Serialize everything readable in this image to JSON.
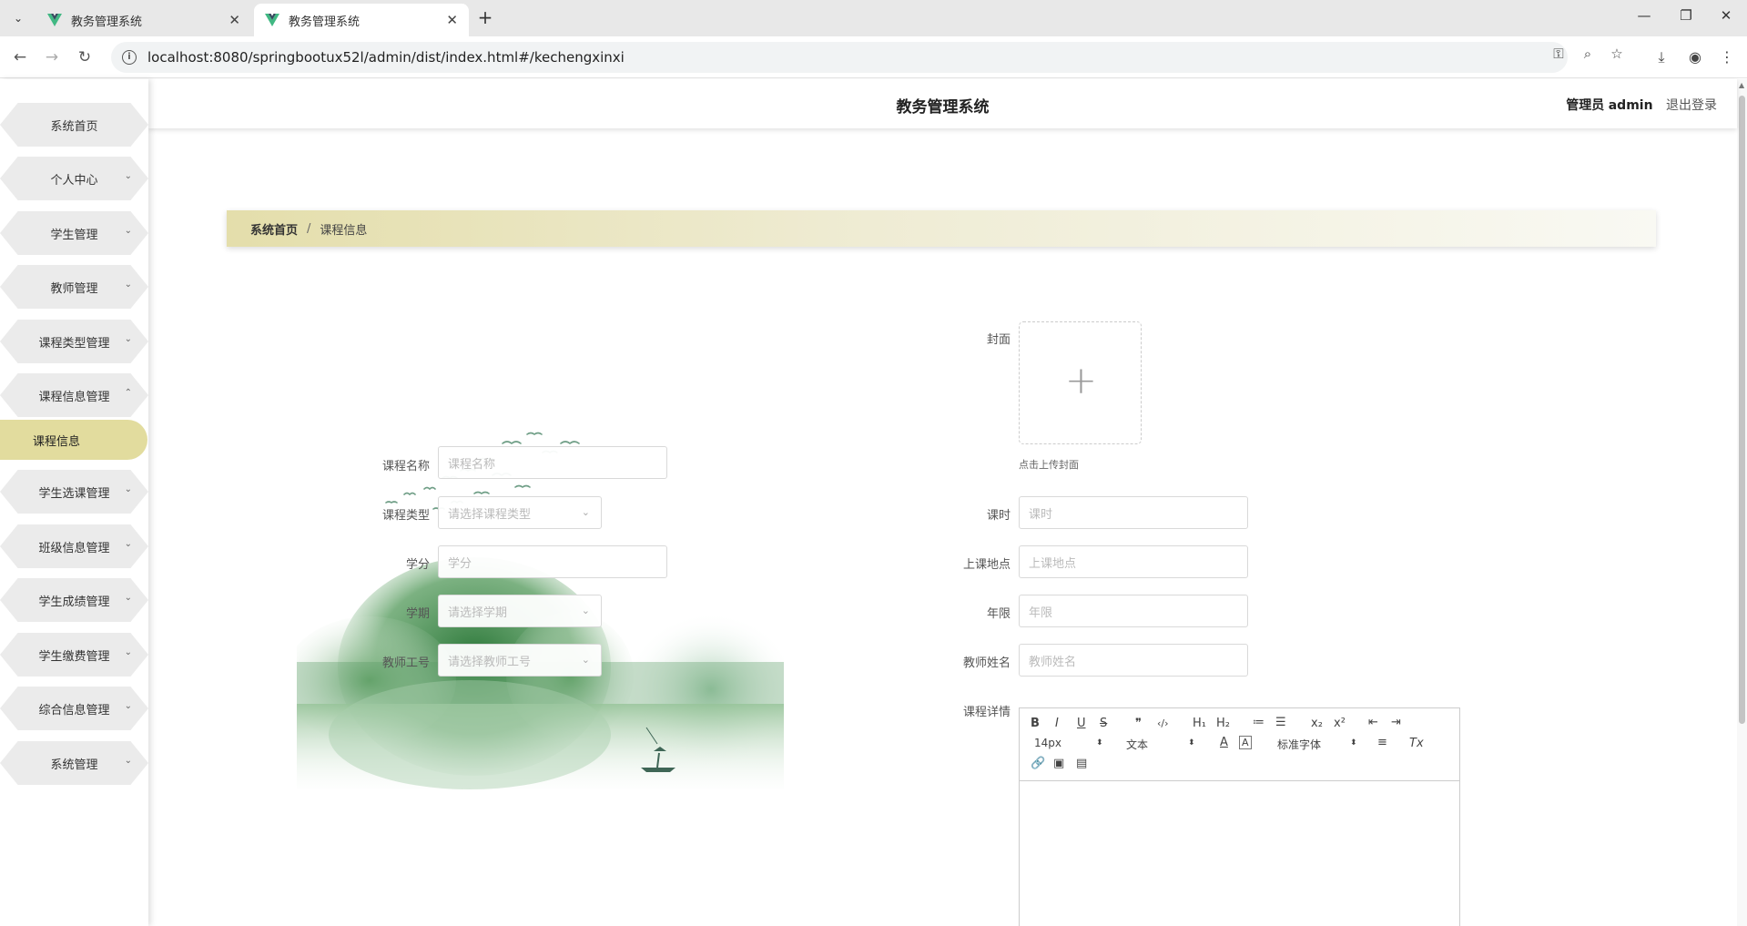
{
  "browser": {
    "tabs": [
      {
        "title": "教务管理系统",
        "active": false
      },
      {
        "title": "教务管理系统",
        "active": true
      }
    ],
    "url": "localhost:8080/springbootux52l/admin/dist/index.html#/kechengxinxi",
    "icons": [
      "tab-search-icon",
      "back-icon",
      "forward-icon",
      "reload-icon",
      "password-key-icon",
      "zoom-icon",
      "bookmark-star-icon",
      "download-icon",
      "profile-icon",
      "more-icon"
    ]
  },
  "header": {
    "title": "教务管理系统",
    "role": "管理员",
    "username": "admin",
    "logout": "退出登录"
  },
  "sidebar": {
    "items": [
      {
        "label": "系统首页",
        "arrow": ""
      },
      {
        "label": "个人中心",
        "arrow": "⌄"
      },
      {
        "label": "学生管理",
        "arrow": "⌄"
      },
      {
        "label": "教师管理",
        "arrow": "⌄"
      },
      {
        "label": "课程类型管理",
        "arrow": "⌄"
      },
      {
        "label": "课程信息管理",
        "arrow": "⌃"
      },
      {
        "label": "课程信息",
        "arrow": ""
      },
      {
        "label": "学生选课管理",
        "arrow": "⌄"
      },
      {
        "label": "班级信息管理",
        "arrow": "⌄"
      },
      {
        "label": "学生成绩管理",
        "arrow": "⌄"
      },
      {
        "label": "学生缴费管理",
        "arrow": "⌄"
      },
      {
        "label": "综合信息管理",
        "arrow": "⌄"
      },
      {
        "label": "系统管理",
        "arrow": "⌄"
      }
    ],
    "active_color": "#e2dc9e"
  },
  "breadcrumb": {
    "home": "系统首页",
    "separator": "/",
    "current": "课程信息"
  },
  "form": {
    "left": [
      {
        "label": "课程名称",
        "placeholder": "课程名称",
        "type": "input"
      },
      {
        "label": "课程类型",
        "placeholder": "请选择课程类型",
        "type": "select"
      },
      {
        "label": "学分",
        "placeholder": "学分",
        "type": "input"
      },
      {
        "label": "学期",
        "placeholder": "请选择学期",
        "type": "select"
      },
      {
        "label": "教师工号",
        "placeholder": "请选择教师工号",
        "type": "select"
      }
    ],
    "cover": {
      "label": "封面",
      "tip": "点击上传封面"
    },
    "right": [
      {
        "label": "课时",
        "placeholder": "课时"
      },
      {
        "label": "上课地点",
        "placeholder": "上课地点"
      },
      {
        "label": "年限",
        "placeholder": "年限"
      },
      {
        "label": "教师姓名",
        "placeholder": "教师姓名"
      }
    ],
    "detail": {
      "label": "课程详情",
      "toolbar": {
        "buttons_row1": [
          "B",
          "I",
          "U",
          "S",
          "❞",
          "‹/›",
          "H₁",
          "H₂",
          "≔",
          "☰",
          "x₂",
          "x²",
          "⇤",
          "⇥"
        ],
        "size": "14px",
        "format": "文本",
        "font": "标准字体",
        "align": "≡",
        "clear": "Tx",
        "buttons_row3": [
          "🔗",
          "▣",
          "▤"
        ]
      }
    }
  }
}
